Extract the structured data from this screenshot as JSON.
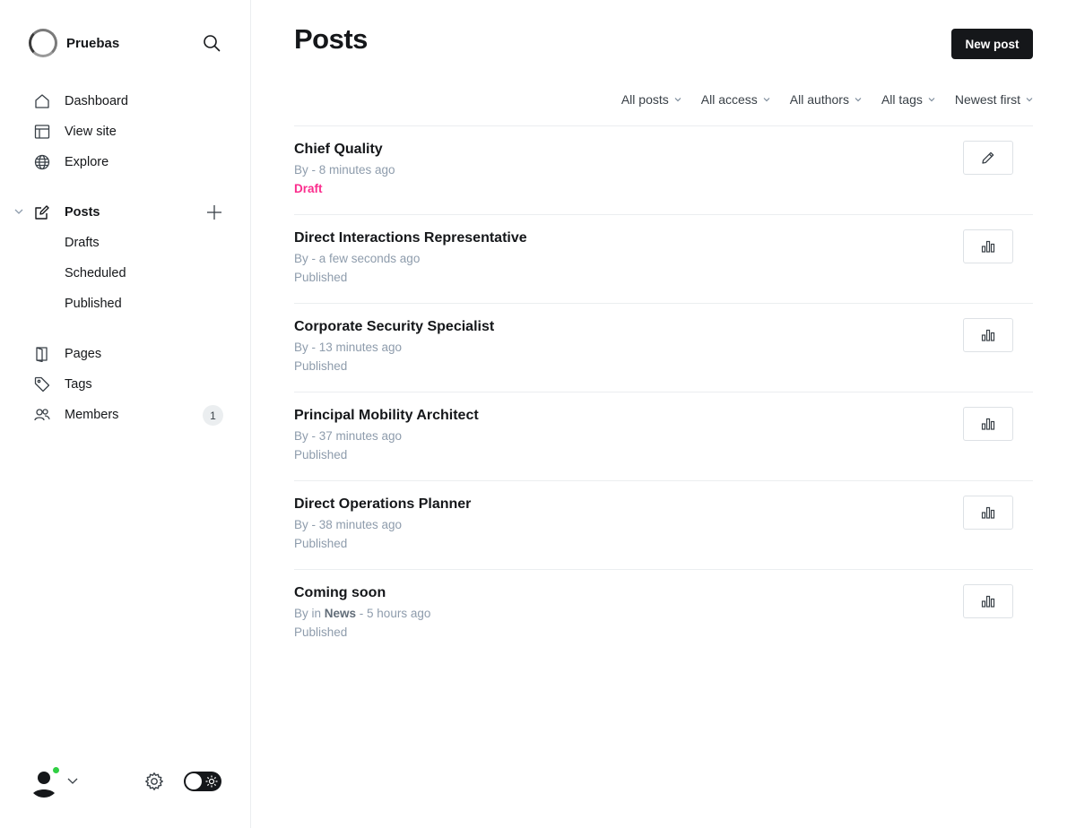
{
  "site": {
    "title": "Pruebas"
  },
  "nav": {
    "dashboard": "Dashboard",
    "view_site": "View site",
    "explore": "Explore",
    "posts": "Posts",
    "drafts": "Drafts",
    "scheduled": "Scheduled",
    "published": "Published",
    "pages": "Pages",
    "tags": "Tags",
    "members": "Members",
    "members_count": "1"
  },
  "main": {
    "title": "Posts",
    "new_post_label": "New post"
  },
  "filters": {
    "type": "All posts",
    "access": "All access",
    "authors": "All authors",
    "tags": "All tags",
    "order": "Newest first"
  },
  "posts": [
    {
      "title": "Chief Quality",
      "meta": "By - 8 minutes ago",
      "status": "Draft",
      "action_icon": "pencil-icon"
    },
    {
      "title": "Direct Interactions Representative",
      "meta": "By - a few seconds ago",
      "status": "Published",
      "action_icon": "stats-icon"
    },
    {
      "title": "Corporate Security Specialist",
      "meta": "By - 13 minutes ago",
      "status": "Published",
      "action_icon": "stats-icon"
    },
    {
      "title": "Principal Mobility Architect",
      "meta": "By - 37 minutes ago",
      "status": "Published",
      "action_icon": "stats-icon"
    },
    {
      "title": "Direct Operations Planner",
      "meta": "By - 38 minutes ago",
      "status": "Published",
      "action_icon": "stats-icon"
    },
    {
      "title": "Coming soon",
      "meta_prefix": "By in ",
      "meta_tag": "News",
      "meta_suffix": " - 5 hours ago",
      "status": "Published",
      "action_icon": "stats-icon"
    }
  ],
  "colors": {
    "accent": "#15171a",
    "draft": "#fb2d8d",
    "muted": "#8e9cac",
    "online": "#30cf43"
  }
}
